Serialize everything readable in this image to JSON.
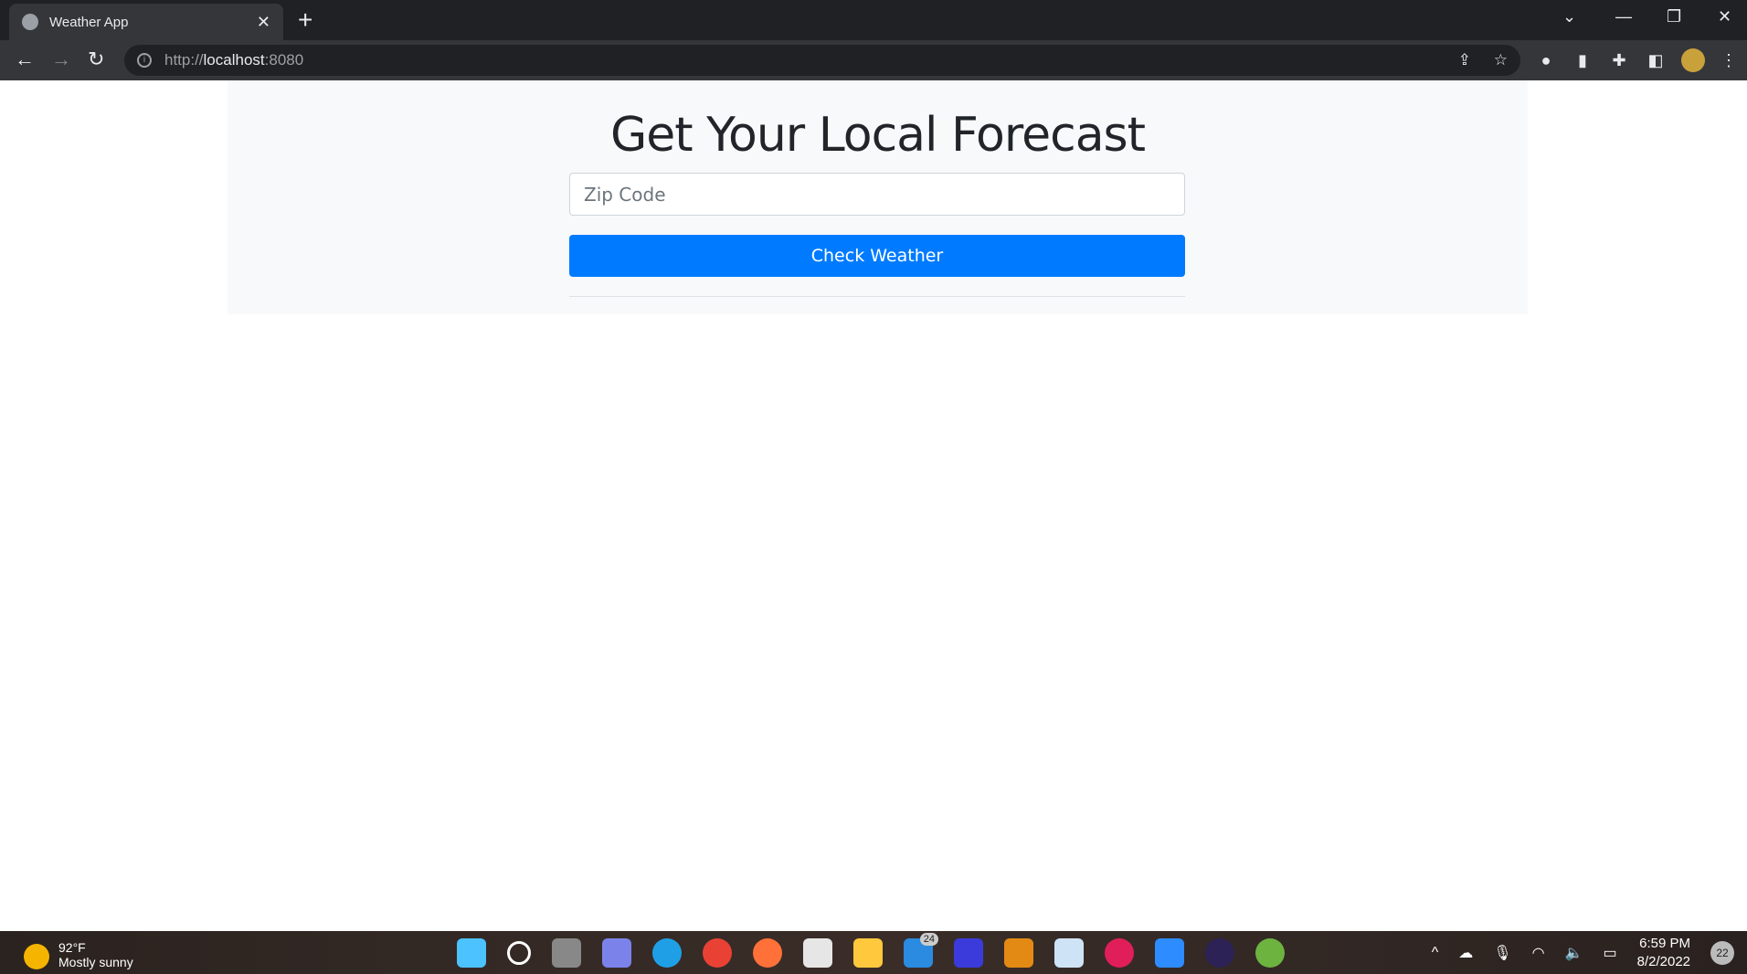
{
  "browser": {
    "tab_title": "Weather App",
    "url_scheme": "http://",
    "url_host": "localhost",
    "url_port": ":8080"
  },
  "page": {
    "heading": "Get Your Local Forecast",
    "zip_placeholder": "Zip Code",
    "zip_value": "",
    "button_label": "Check Weather"
  },
  "taskbar": {
    "temperature": "92°F",
    "condition": "Mostly sunny",
    "mail_badge": "24",
    "time": "6:59 PM",
    "date": "8/2/2022",
    "notifications": "22"
  },
  "colors": {
    "primary": "#007bff"
  }
}
